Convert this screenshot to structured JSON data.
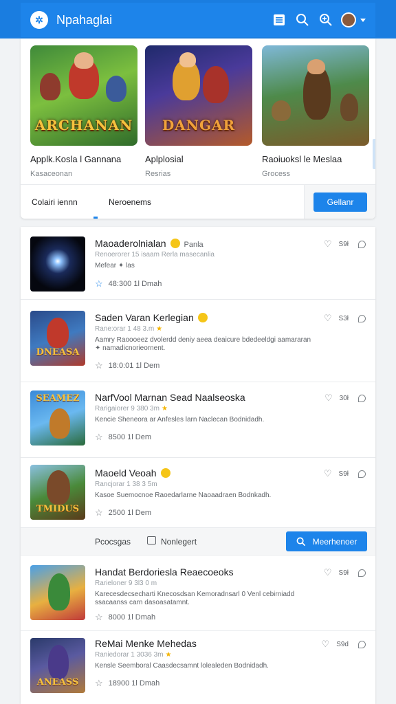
{
  "app": {
    "title": "Npahaglai",
    "logo_glyph": "✲"
  },
  "topbar_icons": [
    "list-icon",
    "search-icon",
    "zoom-icon",
    "avatar",
    "chevron-down-icon"
  ],
  "featured": [
    {
      "title": "Applk.Kosla l Gannana",
      "subtitle": "Kasaceonan",
      "art_text": "ARCHANAN"
    },
    {
      "title": "Aplplosial",
      "subtitle": "Resrias",
      "art_text": "DANGAR"
    },
    {
      "title": "Raoiuoksl le Meslaa",
      "subtitle": "Grocess",
      "art_text": ""
    }
  ],
  "tabs": {
    "tab1": "Colairi iennn",
    "tab2": "Neroenems",
    "button": "Gellanr"
  },
  "items": [
    {
      "title": "Maoaderolnialan",
      "badge": "Panla",
      "meta": "Renoerorer 15 isaam Rerla masecanlia",
      "desc": "Mefear ✦ las",
      "stats": "48:300  1l Dmah",
      "likes": "S9ł",
      "art_text": ""
    },
    {
      "title": "Saden Varan Kerlegian",
      "badge": "",
      "meta": "Rane:orar 1 48 3.m",
      "desc": "Aamry Raoooeez dvolerdd deniy aeea deaicure bdedeeldgi aamararan ✦ namadicnorieornent.",
      "stats": "18:0:01  1l Dem",
      "likes": "S3ł",
      "art_text": "DNEASA"
    },
    {
      "title": "NarfVool Marnan Sead Naalseoska",
      "badge": "",
      "meta": "Rarigaiorer 9 380 3m",
      "desc": "Kencie Sheneora ar Anfesles larn Naclecan Bodnidadh.",
      "stats": "8500  1l Dem",
      "likes": "30ł",
      "art_text": "SEAMEZ"
    },
    {
      "title": "Maoeld Veoah",
      "badge": "",
      "meta": "Rancjorar 1 38 3 5m",
      "desc": "Kasoe Suemocnoe Raoedarlarne Naoaadraen Bodnkadh.",
      "stats": "2500  1l Dem",
      "likes": "S9ł",
      "art_text": "TMIDUS"
    },
    {
      "title": "Handat Berdoriesla Reaecoeoks",
      "badge": "",
      "meta": "Rarieloner 9 3l3 0 m",
      "desc": "Karecesdecsecharti Knecosdsan Kemoradnsarl 0 Venl cebirniadd ssacaanss carn dasoasatamnt.",
      "stats": "8000  1l Dmah",
      "likes": "S9ł",
      "art_text": ""
    },
    {
      "title": "ReMai Menke Mehedas",
      "badge": "",
      "meta": "Raniedorar 1 3036 3m",
      "desc": "Kensle Seemboral Caasdecsamnt lolealeden Bodnidadh.",
      "stats": "18900  1l Dmah",
      "likes": "S9d",
      "art_text": "ANEASS"
    }
  ],
  "mid_bar": {
    "link1": "Pcocsgas",
    "link2": "Nonlegert",
    "button": "Meerhenoer"
  }
}
